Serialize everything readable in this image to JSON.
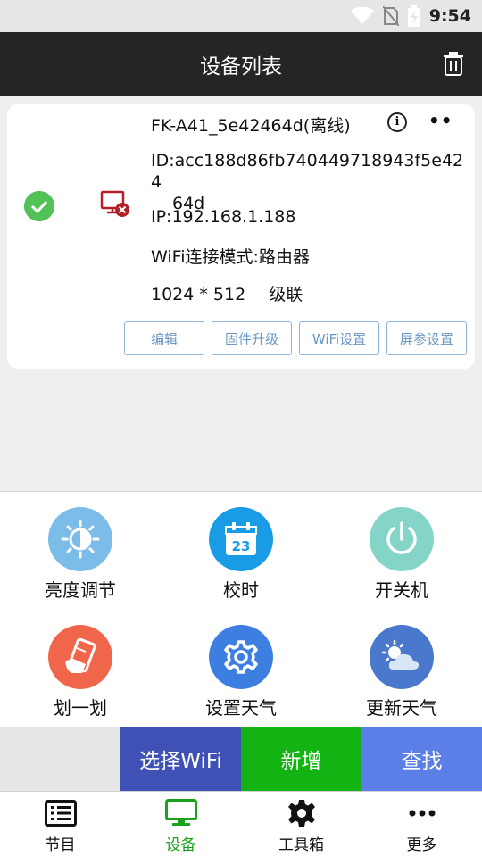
{
  "status": {
    "time": "9:54"
  },
  "header": {
    "title": "设备列表"
  },
  "device": {
    "name": "FK-A41_5e42464d(离线)",
    "id_line1": "ID:acc188d86fb740449718943f5e424",
    "id_line2": "64d",
    "ip": "IP:192.168.1.188",
    "wifi_mode": "WiFi连接模式:路由器",
    "resolution": "1024 * 512",
    "cascade": "级联",
    "info_glyph": "i",
    "more_glyph": "••",
    "buttons": {
      "edit": "编辑",
      "firmware": "固件升级",
      "wifi": "WiFi设置",
      "screen": "屏参设置"
    }
  },
  "functions": [
    {
      "label": "亮度调节",
      "icon": "brightness-icon",
      "color": "#7bbde8"
    },
    {
      "label": "校时",
      "icon": "calendar-icon",
      "color": "#1a9be6",
      "calendar_day": "23"
    },
    {
      "label": "开关机",
      "icon": "power-icon",
      "color": "#85d4c8"
    },
    {
      "label": "划一划",
      "icon": "swipe-phone-icon",
      "color": "#f0664a"
    },
    {
      "label": "设置天气",
      "icon": "gear-icon",
      "color": "#3d7fe0"
    },
    {
      "label": "更新天气",
      "icon": "weather-icon",
      "color": "#4a78cc"
    }
  ],
  "actions": {
    "select_wifi": "选择WiFi",
    "add": "新增",
    "find": "查找",
    "colors": {
      "select_wifi": "#3f51b5",
      "add": "#12b312",
      "find": "#5b7fe6"
    }
  },
  "tabs": [
    {
      "label": "节目",
      "active": false
    },
    {
      "label": "设备",
      "active": true
    },
    {
      "label": "工具箱",
      "active": false
    },
    {
      "label": "更多",
      "active": false
    }
  ],
  "colors": {
    "tab_active": "#1aa31a",
    "tab_inactive": "#111111",
    "online": "#52c158",
    "offline": "#b3202a"
  }
}
